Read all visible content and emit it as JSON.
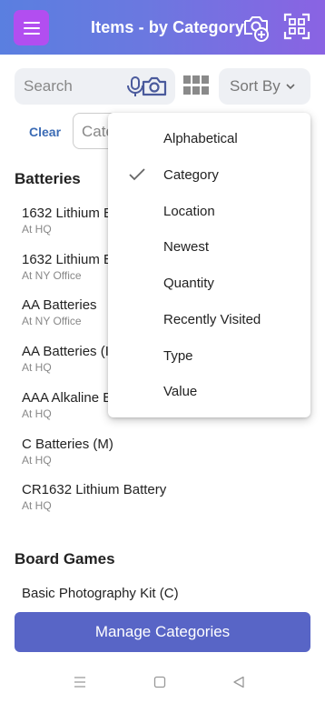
{
  "header": {
    "title": "Items - by Category",
    "menu_icon": "hamburger-icon",
    "add_photo_icon": "camera-add-icon",
    "scan_icon": "qr-scan-icon"
  },
  "toolbar": {
    "search_placeholder": "Search",
    "mic_icon": "microphone-icon",
    "camera_icon": "camera-icon",
    "grid_icon": "grid-view-icon",
    "sort_label": "Sort By"
  },
  "filter": {
    "clear_label": "Clear",
    "category_placeholder": "Cate"
  },
  "sort_menu": {
    "selected": "Category",
    "options": [
      "Alphabetical",
      "Category",
      "Location",
      "Newest",
      "Quantity",
      "Recently Visited",
      "Type",
      "Value"
    ]
  },
  "sections": [
    {
      "title": "Batteries",
      "items": [
        {
          "name": "1632 Lithium E",
          "location": "At HQ"
        },
        {
          "name": "1632 Lithium E",
          "location": "At NY Office"
        },
        {
          "name": "AA Batteries",
          "location": "At NY Office"
        },
        {
          "name": "AA Batteries (I",
          "location": "At HQ"
        },
        {
          "name": "AAA Alkaline E",
          "location": "At HQ"
        },
        {
          "name": "C Batteries (M)",
          "location": "At HQ"
        },
        {
          "name": "CR1632 Lithium Battery",
          "location": "At HQ"
        }
      ]
    },
    {
      "title": "Board Games",
      "items": [
        {
          "name": "Basic Photography Kit (C)",
          "location": ""
        }
      ]
    }
  ],
  "footer": {
    "manage_label": "Manage Categories"
  },
  "colors": {
    "header_start": "#5a7fe0",
    "header_end": "#8a63e3",
    "menu_button": "#b24ef0",
    "manage_button": "#5865c6",
    "link": "#3b6bb5"
  }
}
